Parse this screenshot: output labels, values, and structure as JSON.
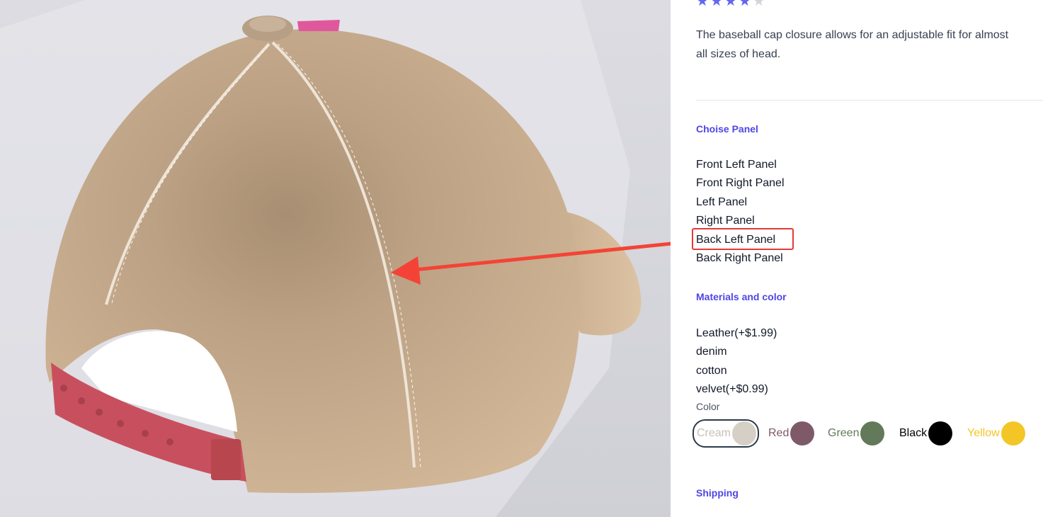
{
  "product": {
    "rating": {
      "value": 4,
      "max": 5
    },
    "description_lines": [
      "The baseball cap closure allows for an adjustable fit for almost",
      "all sizes of head."
    ]
  },
  "choise_panel": {
    "title": "Choise Panel",
    "items": [
      "Front Left Panel",
      "Front Right Panel",
      "Left Panel",
      "Right Panel",
      "Back Left Panel",
      "Back Right Panel"
    ],
    "highlighted": "Back Left Panel"
  },
  "materials": {
    "title": "Materials and color",
    "items": [
      "Leather(+$1.99)",
      "denim",
      "cotton",
      "velvet(+$0.99)"
    ],
    "color_label": "Color",
    "colors": [
      {
        "name": "Cream",
        "hex": "#d6cfc6",
        "text_color": "#c8bfb4",
        "selected": true
      },
      {
        "name": "Red",
        "hex": "#7e5a68",
        "text_color": "#7e5a68",
        "selected": false
      },
      {
        "name": "Green",
        "hex": "#62795a",
        "text_color": "#62795a",
        "selected": false
      },
      {
        "name": "Black",
        "hex": "#000000",
        "text_color": "#000000",
        "selected": false
      },
      {
        "name": "Yellow",
        "hex": "#f4c526",
        "text_color": "#f4c526",
        "selected": false
      }
    ]
  },
  "shipping": {
    "title": "Shipping"
  },
  "annotation": {
    "color": "#f44336"
  },
  "viewer": {
    "cap_color": "#c4a888",
    "strap_color": "#c8505e",
    "button_color": "#b79f86"
  }
}
